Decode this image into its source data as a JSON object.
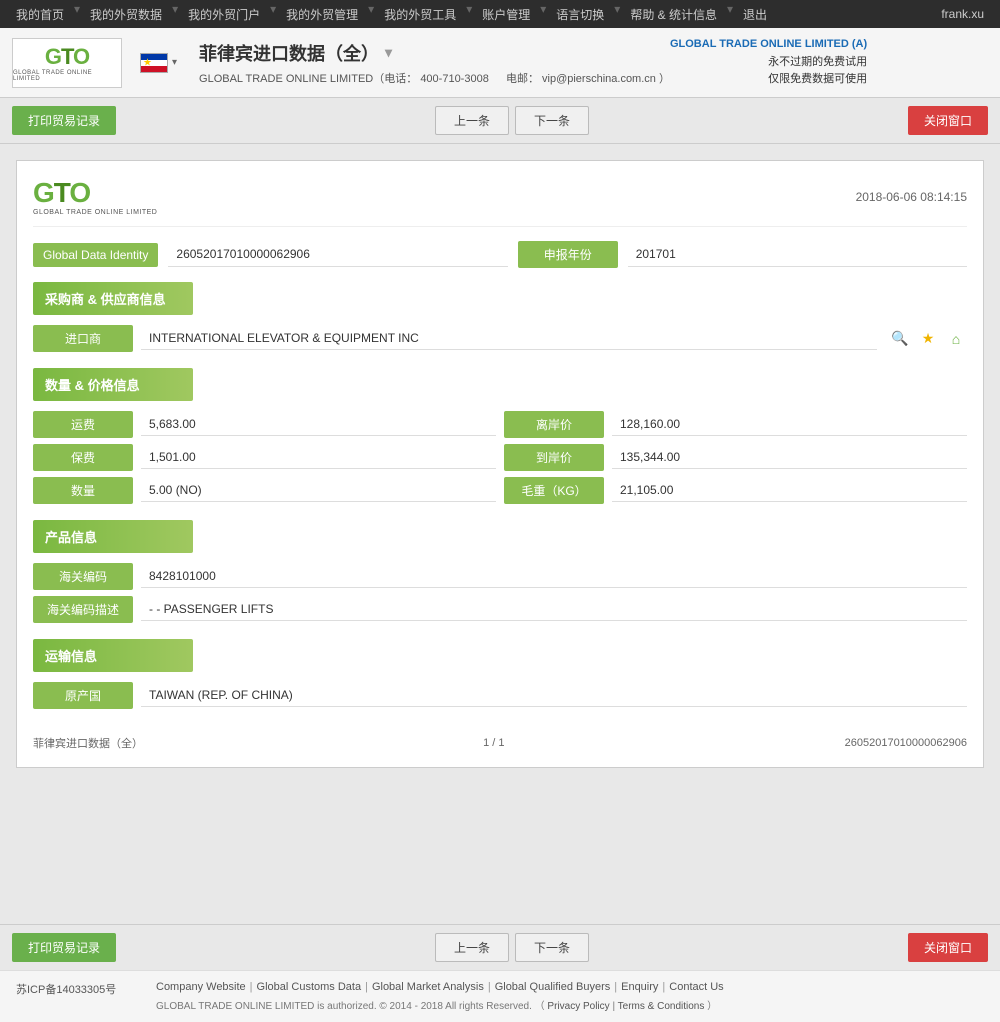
{
  "nav": {
    "items": [
      {
        "label": "我的首页",
        "arrow": true
      },
      {
        "label": "我的外贸数据",
        "arrow": true
      },
      {
        "label": "我的外贸门户",
        "arrow": true
      },
      {
        "label": "我的外贸管理",
        "arrow": true
      },
      {
        "label": "我的外贸工具",
        "arrow": true
      },
      {
        "label": "账户管理",
        "arrow": true
      },
      {
        "label": "语言切换",
        "arrow": true
      },
      {
        "label": "帮助 & 统计信息",
        "arrow": true
      },
      {
        "label": "退出"
      }
    ],
    "user": "frank.xu"
  },
  "header": {
    "logo_text": "GTO",
    "logo_subtitle": "GLOBAL TRADE ONLINE LIMITED",
    "flag_alt": "Philippines flag",
    "title": "菲律宾进口数据（全）",
    "title_arrow": "▾",
    "contact_phone": "400-710-3008",
    "contact_email": "vip@pierschina.com.cn",
    "contact_label": "GLOBAL TRADE ONLINE LIMITED（电话：",
    "contact_mid": "电邮：",
    "notice_brand": "GLOBAL TRADE ONLINE LIMITED (A)",
    "notice_line1": "永不过期的免费试用",
    "notice_line2": "仅限免费数据可使用"
  },
  "toolbar": {
    "print_label": "打印贸易记录",
    "prev_label": "上一条",
    "next_label": "下一条",
    "close_label": "关闭窗口"
  },
  "record": {
    "datetime": "2018-06-06 08:14:15",
    "global_data_identity_label": "Global Data Identity",
    "global_data_identity_value": "26052017010000062906",
    "declaration_year_label": "申报年份",
    "declaration_year_value": "201701",
    "section_supplier": "采购商 & 供应商信息",
    "importer_label": "进口商",
    "importer_value": "INTERNATIONAL ELEVATOR & EQUIPMENT INC",
    "section_quantity": "数量 & 价格信息",
    "freight_label": "运费",
    "freight_value": "5,683.00",
    "departure_price_label": "离岸价",
    "departure_price_value": "128,160.00",
    "insurance_label": "保费",
    "insurance_value": "1,501.00",
    "arrival_price_label": "到岸价",
    "arrival_price_value": "135,344.00",
    "quantity_label": "数量",
    "quantity_value": "5.00 (NO)",
    "gross_weight_label": "毛重（KG）",
    "gross_weight_value": "21,105.00",
    "section_product": "产品信息",
    "customs_code_label": "海关编码",
    "customs_code_value": "8428101000",
    "customs_desc_label": "海关编码描述",
    "customs_desc_value": "- - PASSENGER LIFTS",
    "section_transport": "运输信息",
    "origin_country_label": "原产国",
    "origin_country_value": "TAIWAN (REP. OF CHINA)",
    "page_info_left": "菲律宾进口数据（全）",
    "page_info_mid": "1 / 1",
    "page_info_right": "26052017010000062906"
  },
  "footer": {
    "links": [
      {
        "label": "Company Website"
      },
      {
        "label": "Global Customs Data"
      },
      {
        "label": "Global Market Analysis"
      },
      {
        "label": "Global Qualified Buyers"
      },
      {
        "label": "Enquiry"
      },
      {
        "label": "Contact Us"
      }
    ],
    "copyright": "GLOBAL TRADE ONLINE LIMITED is authorized. © 2014 - 2018 All rights Reserved. （",
    "privacy_label": "Privacy Policy",
    "sep": "|",
    "terms_label": "Terms & Conditions",
    "copyright_end": "）",
    "icp": "苏ICP备14033305号"
  }
}
